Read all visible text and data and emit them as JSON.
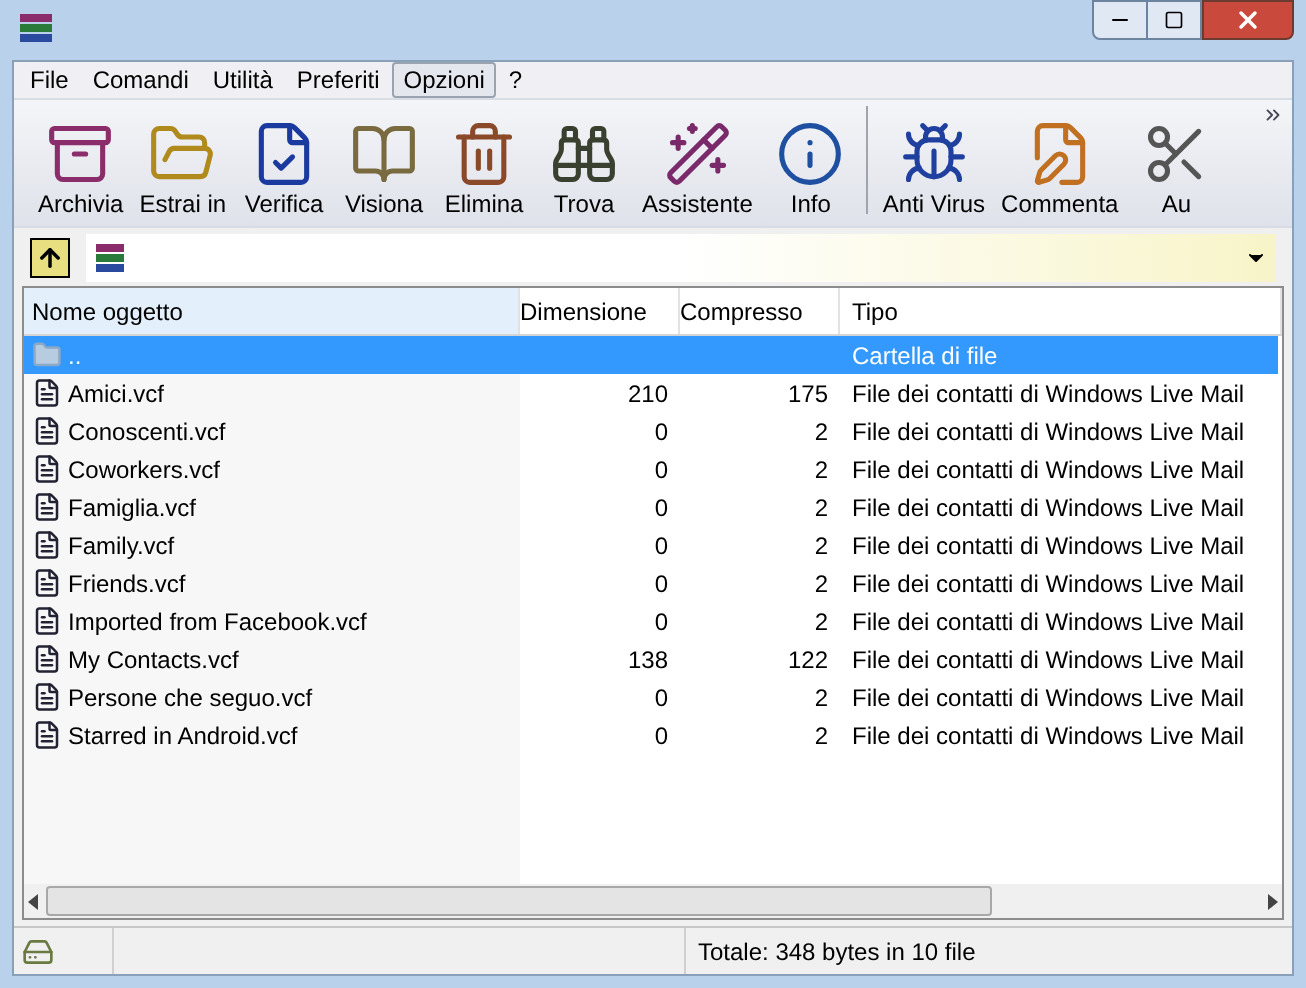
{
  "menu": [
    {
      "label": "File",
      "selected": false
    },
    {
      "label": "Comandi",
      "selected": false
    },
    {
      "label": "Utilità",
      "selected": false
    },
    {
      "label": "Preferiti",
      "selected": false
    },
    {
      "label": "Opzioni",
      "selected": true
    },
    {
      "label": "?",
      "selected": false
    }
  ],
  "toolbar": [
    {
      "label": "Archivia",
      "kind": "archive"
    },
    {
      "label": "Estrai in",
      "kind": "extract"
    },
    {
      "label": "Verifica",
      "kind": "test"
    },
    {
      "label": "Visiona",
      "kind": "view"
    },
    {
      "label": "Elimina",
      "kind": "delete"
    },
    {
      "label": "Trova",
      "kind": "find"
    },
    {
      "label": "Assistente",
      "kind": "wizard"
    },
    {
      "label": "Info",
      "kind": "info"
    },
    {
      "label": "Anti Virus",
      "kind": "virus",
      "separator_before": true
    },
    {
      "label": "Commenta",
      "kind": "comment"
    },
    {
      "label": "Au",
      "kind": "cut"
    }
  ],
  "table": {
    "columns": [
      "Nome oggetto",
      "Dimensione",
      "Compresso",
      "Tipo"
    ],
    "rows": [
      {
        "name": "..",
        "size": "",
        "packed": "",
        "type": "Cartella di file",
        "kind": "folder",
        "selected": true
      },
      {
        "name": "Amici.vcf",
        "size": "210",
        "packed": "175",
        "type": "File dei contatti di Windows Live Mail",
        "kind": "file",
        "selected": false
      },
      {
        "name": "Conoscenti.vcf",
        "size": "0",
        "packed": "2",
        "type": "File dei contatti di Windows Live Mail",
        "kind": "file",
        "selected": false
      },
      {
        "name": "Coworkers.vcf",
        "size": "0",
        "packed": "2",
        "type": "File dei contatti di Windows Live Mail",
        "kind": "file",
        "selected": false
      },
      {
        "name": "Famiglia.vcf",
        "size": "0",
        "packed": "2",
        "type": "File dei contatti di Windows Live Mail",
        "kind": "file",
        "selected": false
      },
      {
        "name": "Family.vcf",
        "size": "0",
        "packed": "2",
        "type": "File dei contatti di Windows Live Mail",
        "kind": "file",
        "selected": false
      },
      {
        "name": "Friends.vcf",
        "size": "0",
        "packed": "2",
        "type": "File dei contatti di Windows Live Mail",
        "kind": "file",
        "selected": false
      },
      {
        "name": "Imported from Facebook.vcf",
        "size": "0",
        "packed": "2",
        "type": "File dei contatti di Windows Live Mail",
        "kind": "file",
        "selected": false
      },
      {
        "name": "My Contacts.vcf",
        "size": "138",
        "packed": "122",
        "type": "File dei contatti di Windows Live Mail",
        "kind": "file",
        "selected": false
      },
      {
        "name": "Persone che seguo.vcf",
        "size": "0",
        "packed": "2",
        "type": "File dei contatti di Windows Live Mail",
        "kind": "file",
        "selected": false
      },
      {
        "name": "Starred in Android.vcf",
        "size": "0",
        "packed": "2",
        "type": "File dei contatti di Windows Live Mail",
        "kind": "file",
        "selected": false
      }
    ]
  },
  "status_bar": {
    "text": "Totale: 348 bytes in 10 file"
  }
}
